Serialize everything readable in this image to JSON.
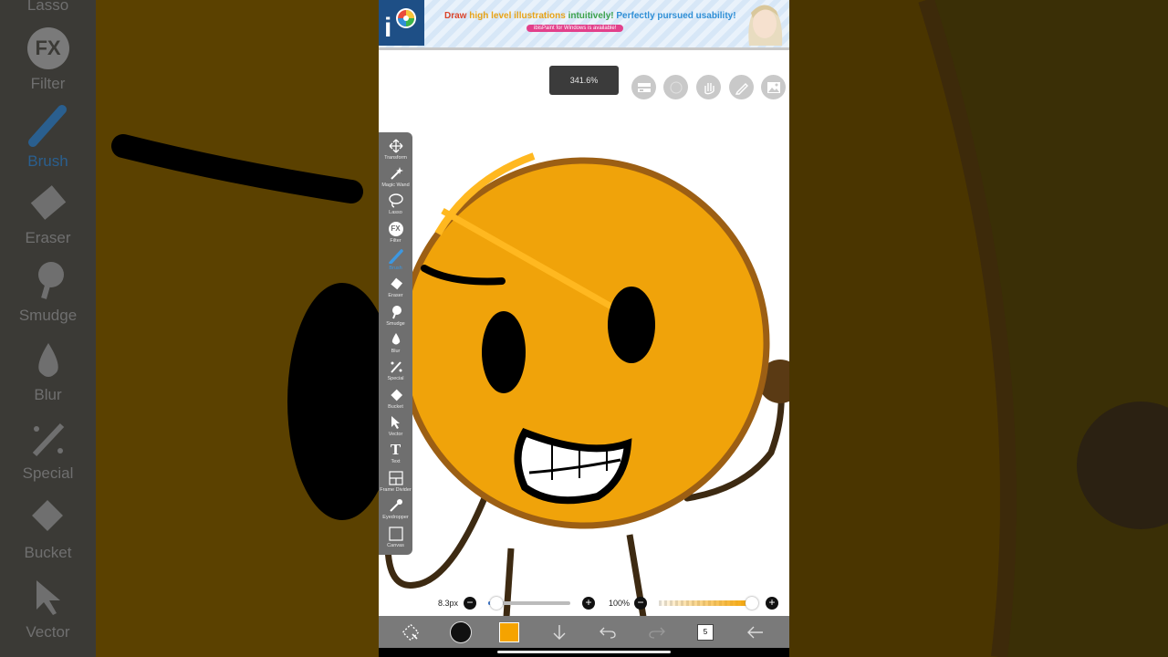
{
  "background_tools": [
    {
      "icon": "lasso-icon",
      "label": "Lasso"
    },
    {
      "icon": "fx-icon",
      "label": "Filter",
      "badge": "FX"
    },
    {
      "icon": "brush-icon",
      "label": "Brush"
    },
    {
      "icon": "eraser-icon",
      "label": "Eraser"
    },
    {
      "icon": "smudge-icon",
      "label": "Smudge"
    },
    {
      "icon": "blur-icon",
      "label": "Blur"
    },
    {
      "icon": "special-icon",
      "label": "Special"
    },
    {
      "icon": "bucket-icon",
      "label": "Bucket"
    },
    {
      "icon": "vector-icon",
      "label": "Vector"
    }
  ],
  "ad": {
    "title_part1": "Draw ",
    "title_part2": "high level illustrations ",
    "title_part3": "intuitively! ",
    "title_part4": "Perfectly pursued usability!",
    "subtitle": "ibisPaint for Windows is available!"
  },
  "zoom_label": "341.6%",
  "top_buttons": [
    "layer-toggle-icon",
    "circle-icon",
    "hand-icon",
    "pen-icon",
    "image-icon"
  ],
  "toolbar": {
    "items": [
      {
        "icon": "transform-icon",
        "label": "Transform"
      },
      {
        "icon": "magic-wand-icon",
        "label": "Magic Wand"
      },
      {
        "icon": "lasso-icon",
        "label": "Lasso"
      },
      {
        "icon": "fx-icon",
        "label": "Filter",
        "badge": "FX"
      },
      {
        "icon": "brush-icon",
        "label": "Brush",
        "active": true
      },
      {
        "icon": "eraser-icon",
        "label": "Eraser"
      },
      {
        "icon": "smudge-icon",
        "label": "Smudge"
      },
      {
        "icon": "blur-icon",
        "label": "Blur"
      },
      {
        "icon": "special-icon",
        "label": "Special"
      },
      {
        "icon": "bucket-icon",
        "label": "Bucket"
      },
      {
        "icon": "vector-icon",
        "label": "Vector"
      },
      {
        "icon": "text-icon",
        "label": "Text",
        "glyph": "T"
      },
      {
        "icon": "frame-divider-icon",
        "label": "Frame Divider"
      },
      {
        "icon": "eyedropper-icon",
        "label": "Eyedropper"
      },
      {
        "icon": "canvas-icon",
        "label": "Canvas"
      }
    ]
  },
  "brush": {
    "size_label": "8.3px",
    "size_fraction": 0.05,
    "opacity_label": "100%",
    "opacity_fraction": 1.0
  },
  "bottom_bar": {
    "layer_count": "5"
  },
  "colors": {
    "brush_color": "#f5a300",
    "active_tool": "#3d97e0"
  }
}
